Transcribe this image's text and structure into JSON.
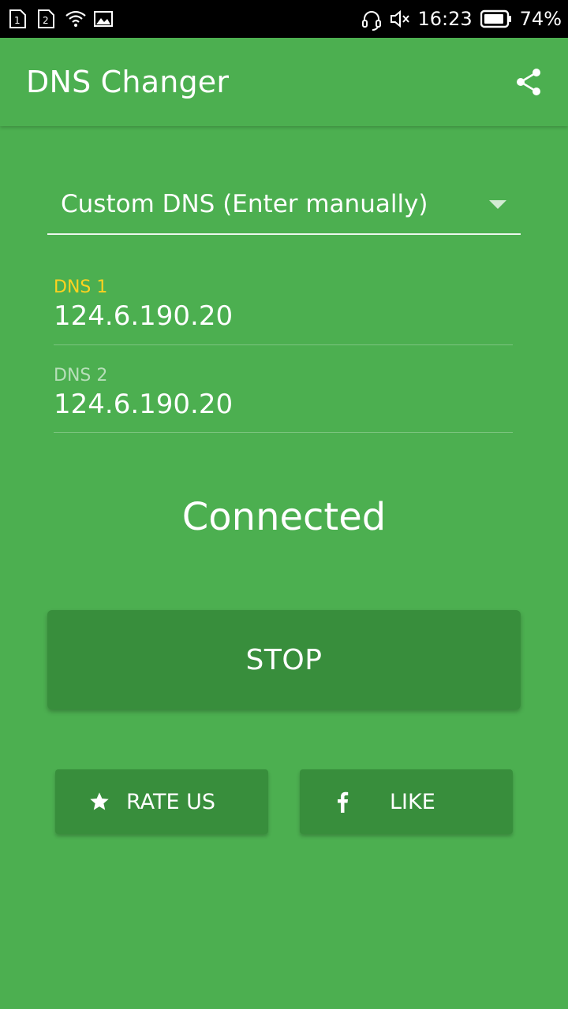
{
  "status_bar": {
    "sim1": "1",
    "sim2": "2",
    "time": "16:23",
    "battery_pct": "74%"
  },
  "app_bar": {
    "title": "DNS Changer",
    "share_icon": "share-icon"
  },
  "dns_selector": {
    "selected": "Custom DNS (Enter manually)"
  },
  "dns1": {
    "label": "DNS 1",
    "value": "124.6.190.20"
  },
  "dns2": {
    "label": "DNS 2",
    "value": "124.6.190.20"
  },
  "connection": {
    "status": "Connected"
  },
  "buttons": {
    "stop": "STOP",
    "rate": "RATE US",
    "like": "LIKE"
  },
  "colors": {
    "background": "#4caf50",
    "button": "#388e3c",
    "active_label": "#ffd21f"
  }
}
